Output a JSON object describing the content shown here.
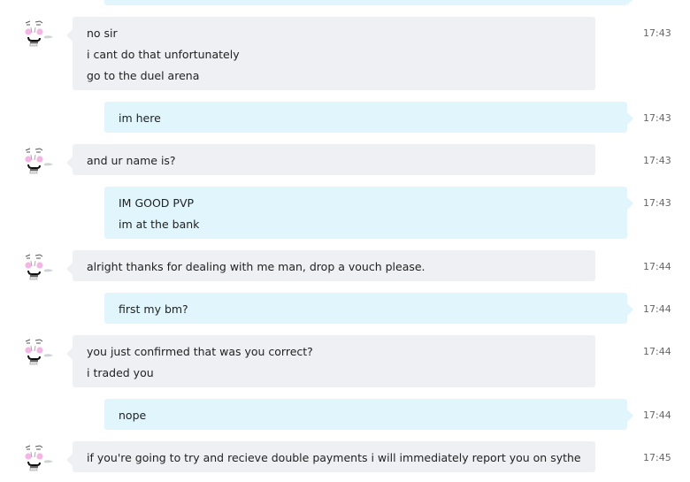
{
  "messages": [
    {
      "direction": "in",
      "lines": [
        "no sir",
        "i cant do that unfortunately",
        "go to the duel arena"
      ],
      "time": "17:43"
    },
    {
      "direction": "out",
      "lines": [
        "im here"
      ],
      "time": "17:43"
    },
    {
      "direction": "in",
      "lines": [
        "and ur name is?"
      ],
      "time": "17:43"
    },
    {
      "direction": "out",
      "lines": [
        "IM GOOD PVP",
        "im at the bank"
      ],
      "time": "17:43"
    },
    {
      "direction": "in",
      "lines": [
        "alright thanks for dealing with me man, drop a vouch please."
      ],
      "time": "17:44"
    },
    {
      "direction": "out",
      "lines": [
        "first my bm?"
      ],
      "time": "17:44"
    },
    {
      "direction": "in",
      "lines": [
        "you just confirmed that was you correct?",
        "i traded you"
      ],
      "time": "17:44"
    },
    {
      "direction": "out",
      "lines": [
        "nope"
      ],
      "time": "17:44"
    },
    {
      "direction": "in",
      "lines": [
        "if you're going to try and recieve double payments i will immediately report you on sythe"
      ],
      "time": "17:45"
    }
  ],
  "colors": {
    "incoming_bubble": "#eef0f4",
    "outgoing_bubble": "#e1f5fc",
    "text": "#222222",
    "timestamp": "#666666",
    "avatar_cheeks": "#f3b6e6"
  },
  "icons": {
    "avatar": "meme-face-avatar-icon"
  }
}
